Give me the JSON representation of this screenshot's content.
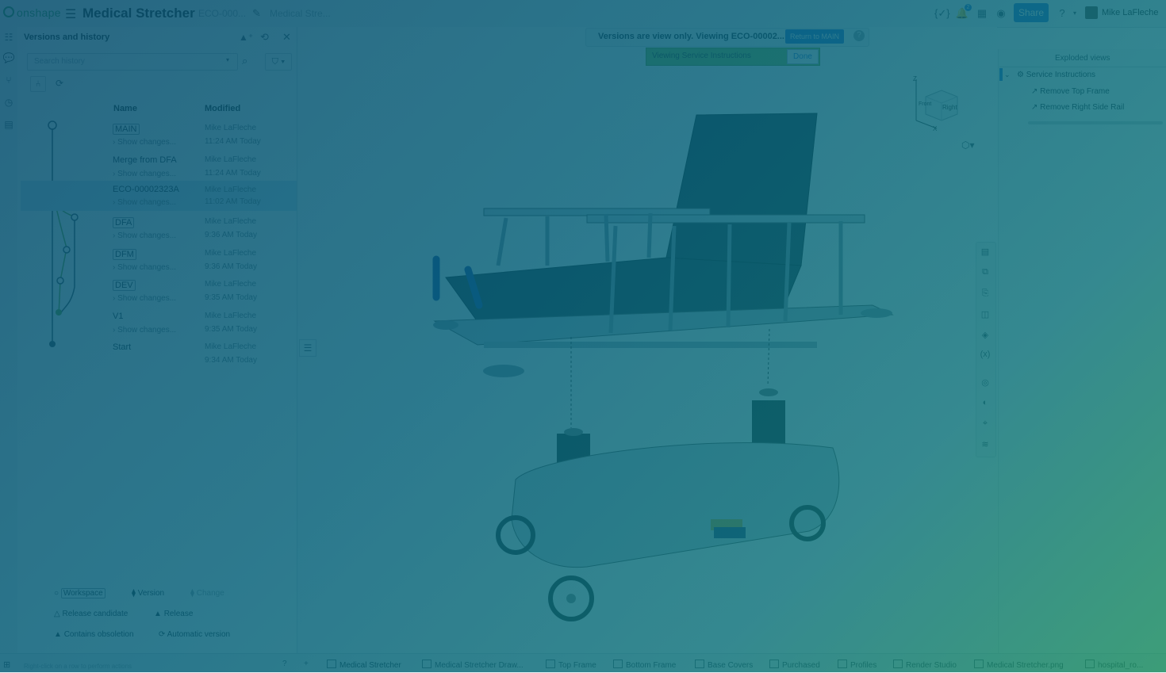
{
  "app": {
    "logo": "onshape",
    "doc_title": "Medical Stretcher",
    "doc_sub": "ECO-000...",
    "breadcrumb": "Medical Stre...",
    "share_label": "Share",
    "user_name": "Mike LaFleche",
    "notifications_count": "2"
  },
  "history": {
    "title": "Versions and history",
    "search_placeholder": "Search history",
    "col_name": "Name",
    "col_modified": "Modified",
    "rows": [
      {
        "name": "MAIN",
        "changes": "Show changes...",
        "author": "Mike LaFleche",
        "time": "11:24 AM Today"
      },
      {
        "name": "Merge from DFA",
        "changes": "Show changes...",
        "author": "Mike LaFleche",
        "time": "11:24 AM Today"
      },
      {
        "name": "ECO-00002323A",
        "changes": "Show changes...",
        "author": "Mike LaFleche",
        "time": "11:02 AM Today"
      },
      {
        "name": "DFA",
        "changes": "Show changes...",
        "author": "Mike LaFleche",
        "time": "9:36 AM Today"
      },
      {
        "name": "DFM",
        "changes": "Show changes...",
        "author": "Mike LaFleche",
        "time": "9:36 AM Today"
      },
      {
        "name": "DEV",
        "changes": "Show changes...",
        "author": "Mike LaFleche",
        "time": "9:35 AM Today"
      },
      {
        "name": "V1",
        "changes": "Show changes...",
        "author": "Mike LaFleche",
        "time": "9:35 AM Today"
      },
      {
        "name": "Start",
        "author": "Mike LaFleche",
        "time": "9:34 AM Today"
      }
    ],
    "legend": {
      "workspace": "Workspace",
      "version": "Version",
      "change": "Change",
      "release_candidate": "Release candidate",
      "release": "Release",
      "contains_obsoletion": "Contains obsoletion",
      "automatic_version": "Automatic version"
    }
  },
  "viewport": {
    "notice": "Versions are view only. Viewing ECO-00002...",
    "return_label": "Return to MAIN",
    "instructions_label": "Viewing Service Instructions",
    "done_label": "Done",
    "cube_front": "Front",
    "cube_right": "Right",
    "axis_z": "Z",
    "axis_x": "X"
  },
  "exploded": {
    "title": "Exploded views",
    "group": "Service Instructions",
    "steps": [
      "Remove Top Frame",
      "Remove Right Side Rail"
    ]
  },
  "status_text": "Right-click on a row to perform actions",
  "tabs": [
    "Medical Stretcher",
    "Medical Stretcher Draw...",
    "Top Frame",
    "Bottom Frame",
    "Base Covers",
    "Purchased",
    "Profiles",
    "Render Studio",
    "Medical Stretcher.png",
    "hospital_ro..."
  ]
}
